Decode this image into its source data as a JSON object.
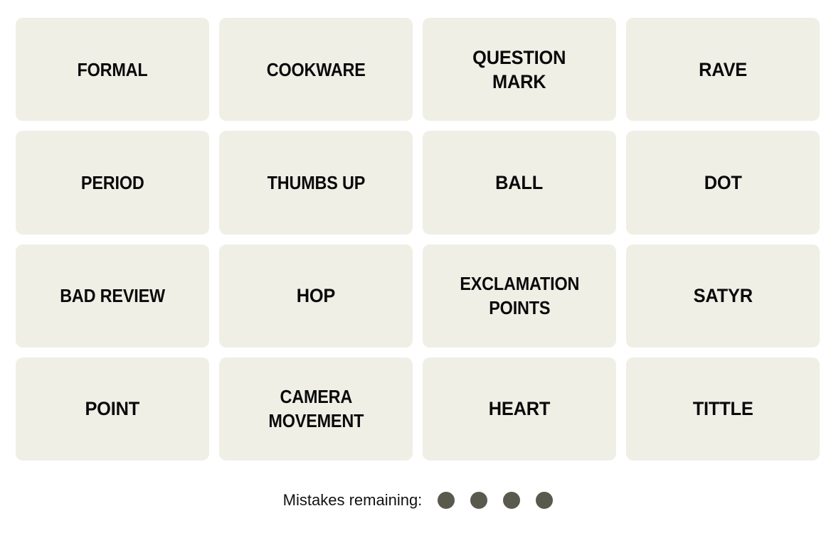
{
  "game": {
    "name": "Connections",
    "tile_background": "#EFEFE6",
    "board_background": "#FFFFFF",
    "text_color": "#0A0A0A"
  },
  "board": {
    "columns": 4,
    "rows": 4,
    "tiles": [
      {
        "label": "FORMAL",
        "lines": 1
      },
      {
        "label": "COOKWARE",
        "lines": 1
      },
      {
        "label": "QUESTION\nMARK",
        "lines": 2
      },
      {
        "label": "RAVE",
        "lines": 1
      },
      {
        "label": "PERIOD",
        "lines": 1
      },
      {
        "label": "THUMBS UP",
        "lines": 1
      },
      {
        "label": "BALL",
        "lines": 1
      },
      {
        "label": "DOT",
        "lines": 1
      },
      {
        "label": "BAD REVIEW",
        "lines": 1
      },
      {
        "label": "HOP",
        "lines": 1
      },
      {
        "label": "EXCLAMATION\nPOINTS",
        "lines": 2
      },
      {
        "label": "SATYR",
        "lines": 1
      },
      {
        "label": "POINT",
        "lines": 1
      },
      {
        "label": "CAMERA\nMOVEMENT",
        "lines": 2
      },
      {
        "label": "HEART",
        "lines": 1
      },
      {
        "label": "TITTLE",
        "lines": 1
      }
    ]
  },
  "mistakes": {
    "label": "Mistakes remaining:",
    "remaining": 4,
    "dot_color": "#5A594E"
  }
}
